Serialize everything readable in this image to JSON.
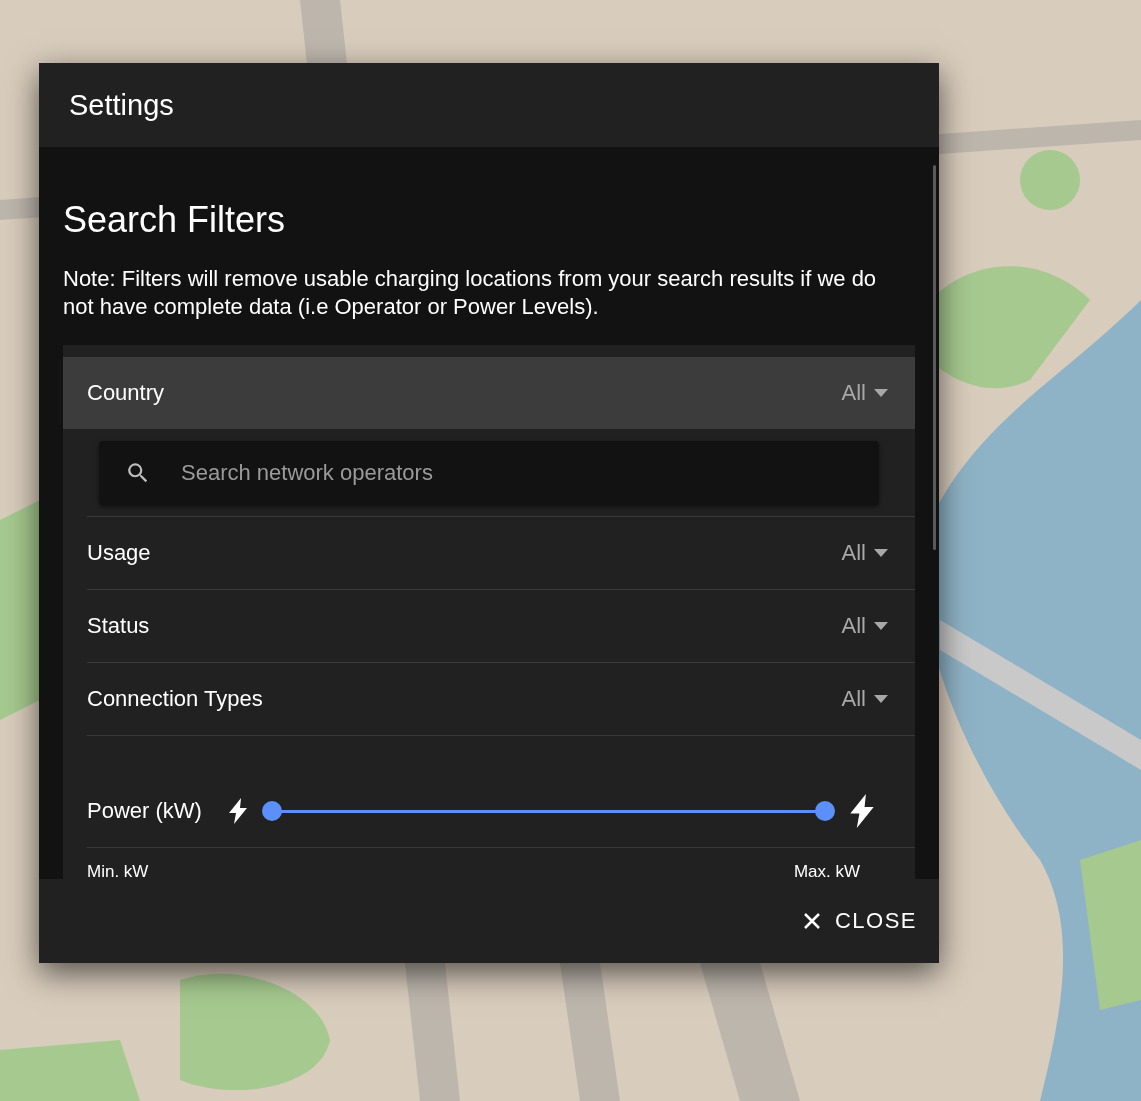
{
  "dialog": {
    "title": "Settings",
    "section_title": "Search Filters",
    "note": "Note: Filters will remove usable charging locations from your search results if we do not have complete data (i.e Operator or Power Levels).",
    "filters": [
      {
        "label": "Country",
        "value": "All",
        "expanded": true,
        "search": {
          "placeholder": "Search network operators"
        }
      },
      {
        "label": "Usage",
        "value": "All",
        "expanded": false
      },
      {
        "label": "Status",
        "value": "All",
        "expanded": false
      },
      {
        "label": "Connection Types",
        "value": "All",
        "expanded": false
      }
    ],
    "power": {
      "label": "Power (kW)",
      "thumbs": [
        {
          "level": 0
        },
        {
          "level": 1
        }
      ],
      "min_label": "Min. kW",
      "max_label": "Max. kW"
    },
    "close_button": "CLOSE"
  }
}
